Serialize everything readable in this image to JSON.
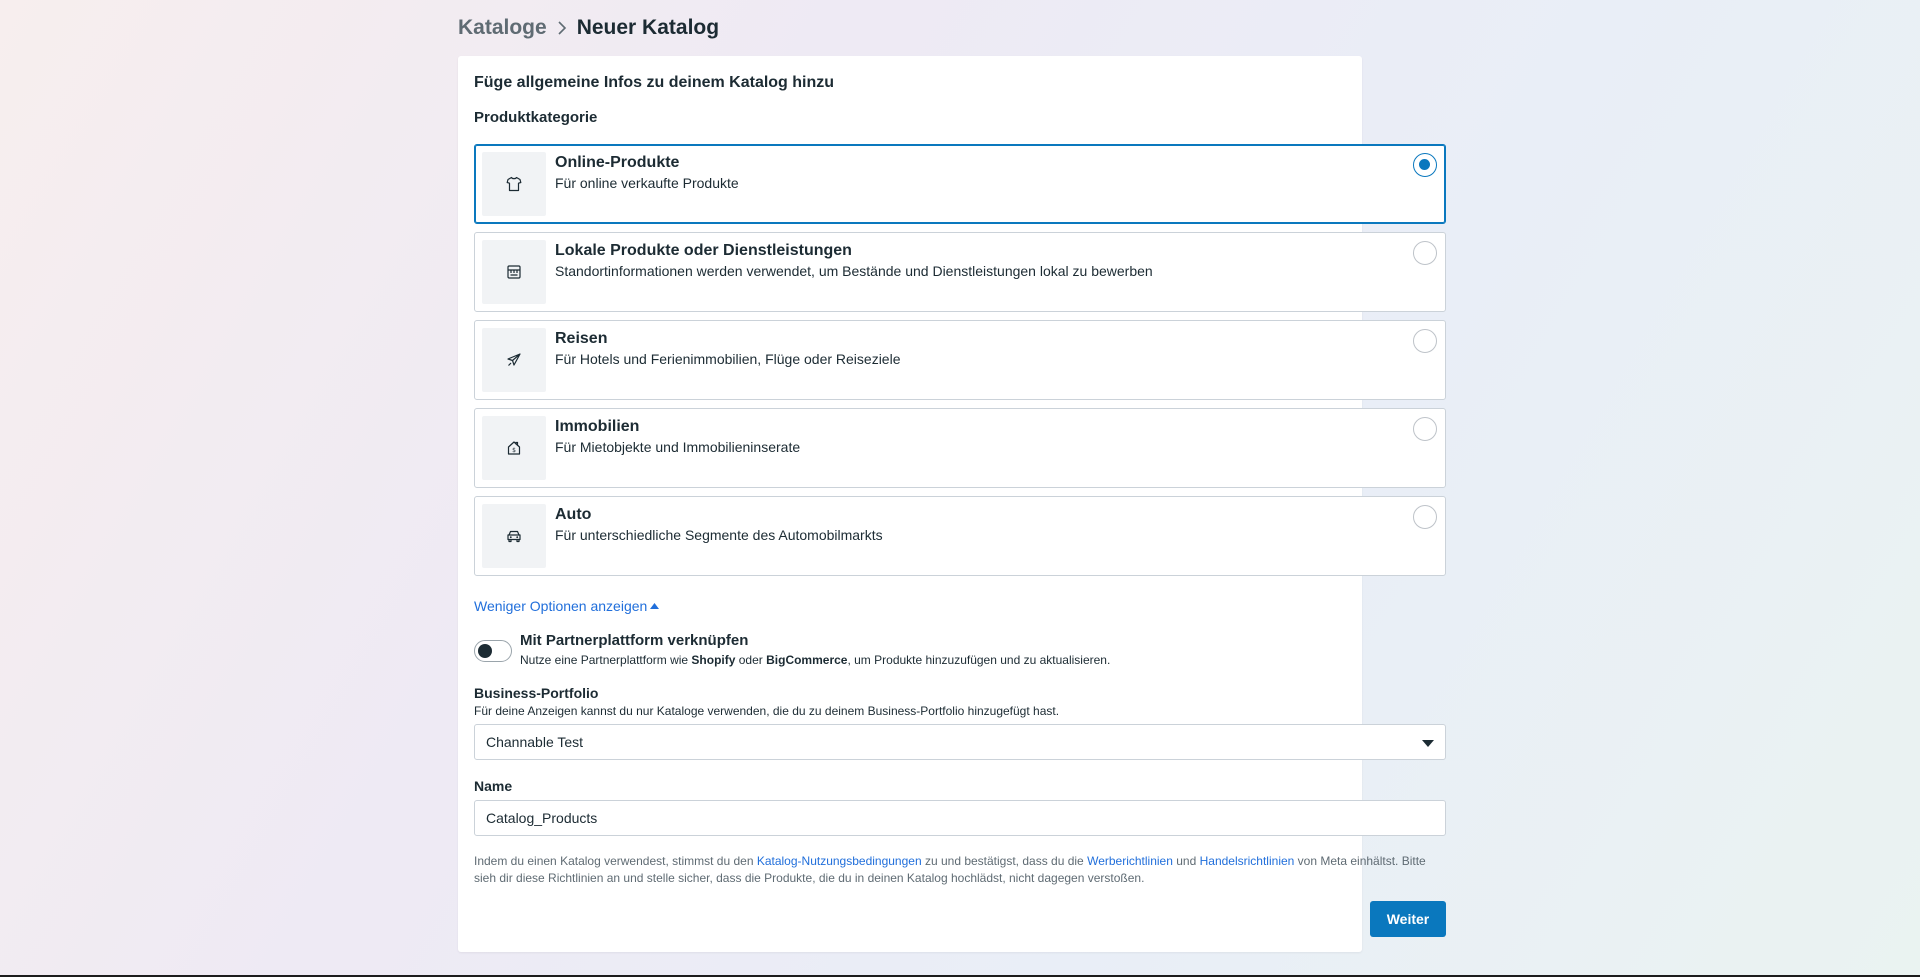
{
  "breadcrumb": {
    "parent": "Kataloge",
    "current": "Neuer Katalog"
  },
  "card": {
    "title": "Füge allgemeine Infos zu deinem Katalog hinzu",
    "category_label": "Produktkategorie"
  },
  "categories": [
    {
      "title": "Online-Produkte",
      "desc": "Für online verkaufte Produkte",
      "icon": "tshirt-icon",
      "selected": true
    },
    {
      "title": "Lokale Produkte oder Dienstleistungen",
      "desc": "Standortinformationen werden verwendet, um Bestände und Dienstleistungen lokal zu bewerben",
      "icon": "store-icon",
      "selected": false
    },
    {
      "title": "Reisen",
      "desc": "Für Hotels und Ferienimmobilien, Flüge oder Reiseziele",
      "icon": "airplane-icon",
      "selected": false
    },
    {
      "title": "Immobilien",
      "desc": "Für Mietobjekte und Immobilieninserate",
      "icon": "house-icon",
      "selected": false
    },
    {
      "title": "Auto",
      "desc": "Für unterschiedliche Segmente des Automobilmarkts",
      "icon": "car-icon",
      "selected": false
    }
  ],
  "less_options": "Weniger Optionen anzeigen",
  "partner": {
    "title": "Mit Partnerplattform verknüpfen",
    "desc_prefix": "Nutze eine Partnerplattform wie ",
    "shopify": "Shopify",
    "desc_or": " oder ",
    "bigcommerce": "BigCommerce",
    "desc_suffix": ", um Produkte hinzuzufügen und zu aktualisieren.",
    "enabled": false
  },
  "business_portfolio": {
    "label": "Business-Portfolio",
    "desc": "Für deine Anzeigen kannst du nur Kataloge verwenden, die du zu deinem Business-Portfolio hinzugefügt hast.",
    "selected": "Channable Test"
  },
  "name": {
    "label": "Name",
    "value": "Catalog_Products"
  },
  "legal": {
    "part1": "Indem du einen Katalog verwendest, stimmst du den ",
    "link1": "Katalog-Nutzungsbedingungen",
    "part2": " zu und bestätigst, dass du die ",
    "link2": "Werberichtlinien",
    "part3": " und ",
    "link3": "Handelsrichtlinien",
    "part4": " von Meta einhältst. Bitte sieh dir diese Richtlinien an und stelle sicher, dass die Produkte, die du in deinen Katalog hochlädst, nicht dagegen verstoßen."
  },
  "next_label": "Weiter",
  "colors": {
    "accent": "#0a78be",
    "link": "#216fdb"
  }
}
